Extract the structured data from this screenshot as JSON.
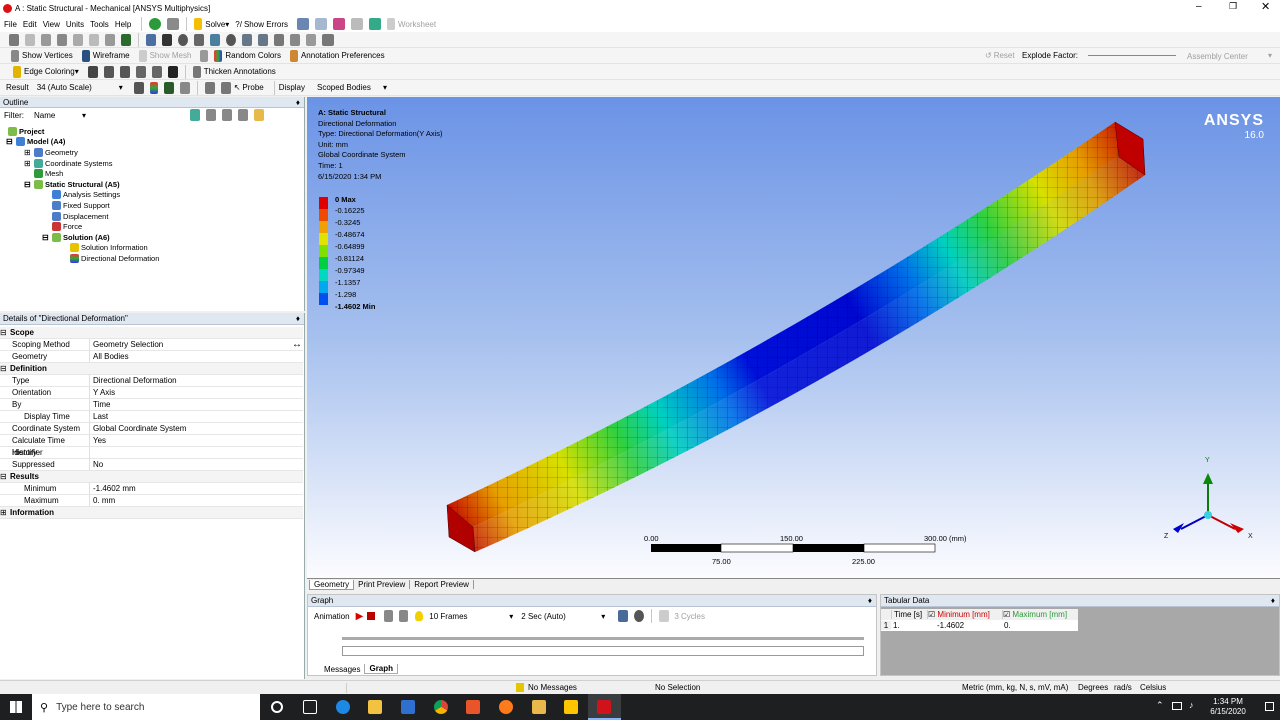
{
  "titlebar": {
    "title": "A : Static Structural - Mechanical [ANSYS Multiphysics]"
  },
  "menu": {
    "items": [
      "File",
      "Edit",
      "View",
      "Units",
      "Tools",
      "Help"
    ],
    "solve": "Solve",
    "show_errors": "Show Errors",
    "worksheet": "Worksheet"
  },
  "toolbar3": {
    "show_vertices": "Show Vertices",
    "wireframe": "Wireframe",
    "show_mesh": "Show Mesh",
    "random_colors": "Random Colors",
    "annotation_prefs": "Annotation Preferences",
    "reset": "Reset",
    "explode_factor": "Explode Factor:",
    "assembly_center": "Assembly Center"
  },
  "toolbar4": {
    "edge_coloring": "Edge Coloring",
    "thicken": "Thicken Annotations"
  },
  "toolbar5": {
    "result_label": "Result",
    "result_value": "34 (Auto Scale)",
    "probe": "Probe",
    "display": "Display",
    "scoped": "Scoped Bodies"
  },
  "outline": {
    "title": "Outline",
    "filter_label": "Filter:",
    "filter_value": "Name",
    "tree": [
      "Project",
      "Model (A4)",
      "Geometry",
      "Coordinate Systems",
      "Mesh",
      "Static Structural (A5)",
      "Analysis Settings",
      "Fixed Support",
      "Displacement",
      "Force",
      "Solution (A6)",
      "Solution Information",
      "Directional Deformation"
    ]
  },
  "details": {
    "title": "Details of \"Directional Deformation\"",
    "scope": "Scope",
    "scoping_method_k": "Scoping Method",
    "scoping_method_v": "Geometry Selection",
    "geometry_k": "Geometry",
    "geometry_v": "All Bodies",
    "definition": "Definition",
    "type_k": "Type",
    "type_v": "Directional Deformation",
    "orientation_k": "Orientation",
    "orientation_v": "Y Axis",
    "by_k": "By",
    "by_v": "Time",
    "display_time_k": "Display Time",
    "display_time_v": "Last",
    "coord_k": "Coordinate System",
    "coord_v": "Global Coordinate System",
    "calc_k": "Calculate Time History",
    "calc_v": "Yes",
    "identifier_k": "Identifier",
    "identifier_v": "",
    "suppressed_k": "Suppressed",
    "suppressed_v": "No",
    "results": "Results",
    "min_k": "Minimum",
    "min_v": "-1.4602 mm",
    "max_k": "Maximum",
    "max_v": "0. mm",
    "information": "Information"
  },
  "viewport": {
    "header": [
      "A: Static Structural",
      "Directional Deformation",
      "Type: Directional Deformation(Y Axis)",
      "Unit: mm",
      "Global Coordinate System",
      "Time: 1",
      "6/15/2020 1:34 PM"
    ],
    "logo": "ANSYS",
    "version": "16.0",
    "legend": [
      {
        "label": "0 Max",
        "color": "#e00000",
        "bold": true
      },
      {
        "label": "-0.16225",
        "color": "#f04a00"
      },
      {
        "label": "-0.3245",
        "color": "#f0a000"
      },
      {
        "label": "-0.48674",
        "color": "#e2e200"
      },
      {
        "label": "-0.64899",
        "color": "#7fe000"
      },
      {
        "label": "-0.81124",
        "color": "#00d040"
      },
      {
        "label": "-0.97349",
        "color": "#00d8c0"
      },
      {
        "label": "-1.1357",
        "color": "#00a8f0"
      },
      {
        "label": "-1.298",
        "color": "#0050f0"
      },
      {
        "label": "-1.4602 Min",
        "color": "#0000d0",
        "bold": true
      }
    ],
    "scale": {
      "t0": "0.00",
      "t150": "150.00",
      "t300": "300.00 (mm)",
      "t75": "75.00",
      "t225": "225.00"
    },
    "axes": {
      "y": "Y",
      "z": "Z",
      "x": "X"
    }
  },
  "bottom_tabs": [
    "Geometry",
    "Print Preview",
    "Report Preview"
  ],
  "graph": {
    "title": "Graph",
    "animation": "Animation",
    "frames": "10 Frames",
    "sec": "2 Sec (Auto)",
    "cycles": "3 Cycles",
    "tabs": [
      "Messages",
      "Graph"
    ]
  },
  "tabular": {
    "title": "Tabular Data",
    "headers": [
      "Time [s]",
      "Minimum [mm]",
      "Maximum [mm]"
    ],
    "row": [
      "1",
      "1.",
      "-1.4602",
      "0."
    ]
  },
  "status": {
    "messages": "No Messages",
    "selection": "No Selection",
    "units": "Metric (mm, kg, N, s, mV, mA)",
    "degrees": "Degrees",
    "rads": "rad/s",
    "celsius": "Celsius"
  },
  "taskbar": {
    "search": "Type here to search",
    "time": "1:34 PM",
    "date": "6/15/2020"
  },
  "colors": {
    "accent": "#0078d7",
    "viewport_top": "#6b93e6",
    "viewport_bottom": "#fcfcff"
  }
}
